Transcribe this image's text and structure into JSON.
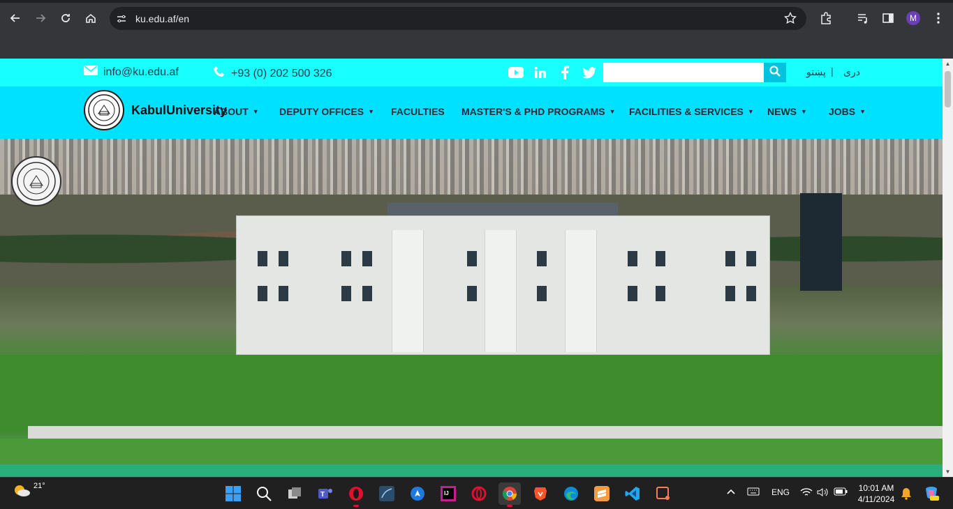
{
  "browser": {
    "url": "ku.edu.af/en",
    "profile_initial": "M",
    "icons": [
      "back-icon",
      "forward-icon",
      "reload-icon",
      "home-icon",
      "site-info-icon",
      "bookmark-star-icon",
      "extensions-icon",
      "media-icon",
      "side-panel-icon",
      "menu-dots-icon"
    ]
  },
  "topbar": {
    "email": "info@ku.edu.af",
    "phone": "+93 (0) 202 500 326",
    "social": [
      "youtube-icon",
      "linkedin-icon",
      "facebook-icon",
      "twitter-icon"
    ],
    "search_placeholder": "",
    "lang_pashto": "پښتو",
    "lang_separator": "|",
    "lang_dari": "دری"
  },
  "nav": {
    "brand": "KabulUniversity",
    "items": [
      {
        "label": "ABOUT",
        "has_caret": true
      },
      {
        "label": "DEPUTY OFFICES",
        "has_caret": true
      },
      {
        "label": "FACULTIES",
        "has_caret": false
      },
      {
        "label": "MASTER'S & PHD PROGRAMS",
        "has_caret": true
      },
      {
        "label": "FACILITIES & SERVICES",
        "has_caret": true
      },
      {
        "label": "NEWS",
        "has_caret": true
      },
      {
        "label": "JOBS",
        "has_caret": true
      }
    ],
    "caret_glyph": "▼"
  },
  "taskbar": {
    "temperature": "21°",
    "apps": [
      "windows-start-icon",
      "search-icon",
      "task-view-icon",
      "teams-icon",
      "opera-gx-icon",
      "sql-icon",
      "copilot-icon",
      "intellij-icon",
      "opera-icon",
      "chrome-icon",
      "brave-icon",
      "edge-icon",
      "sublime-icon",
      "vscode-icon",
      "snipping-icon"
    ],
    "tray_chevron": "^",
    "language": "ENG",
    "time": "10:01 AM",
    "date": "4/11/2024"
  },
  "colors": {
    "topbar_bg": "#18ffff",
    "nav_bg": "#00e1ff",
    "chrome_bg": "#35363a"
  }
}
